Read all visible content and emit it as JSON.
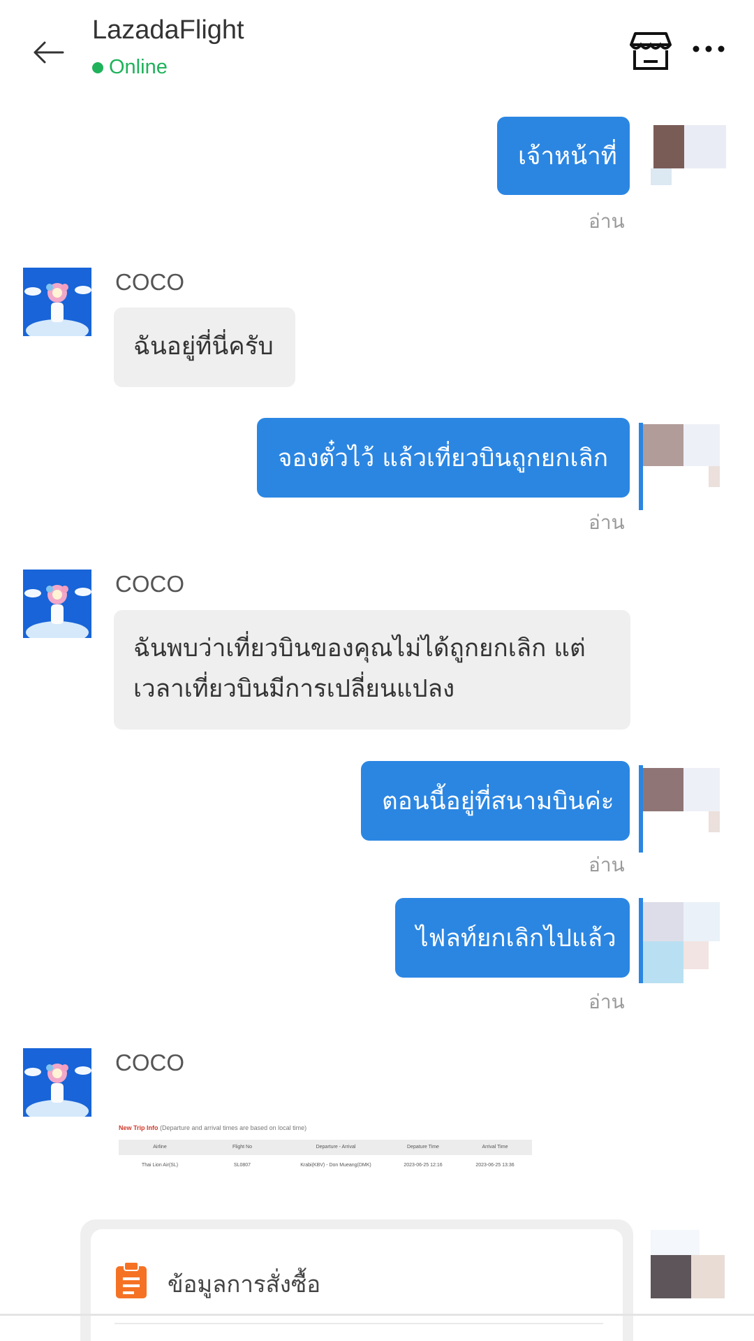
{
  "header": {
    "title": "LazadaFlight",
    "status": "Online",
    "back_icon": "arrow-left-icon",
    "store_icon": "store-icon",
    "more_icon": "more-horizontal-icon"
  },
  "messages": [
    {
      "from": "me",
      "text": "เจ้าหน้าที่",
      "status": "อ่าน"
    },
    {
      "from": "coco",
      "sender": "COCO",
      "text": "ฉันอยู่ที่นี่ครับ"
    },
    {
      "from": "me",
      "text": "จองตั๋วไว้ แล้วเที่ยวบินถูกยกเลิก",
      "status": "อ่าน"
    },
    {
      "from": "coco",
      "sender": "COCO",
      "text_lines": [
        "ฉันพบว่าเที่ยวบินของคุณไม่ได้ถูกยกเลิก แต่",
        "เวลาเที่ยวบินมีการเปลี่ยนแปลง"
      ]
    },
    {
      "from": "me",
      "text": "ตอนนี้อยู่ที่สนามบินค่ะ",
      "status": "อ่าน"
    },
    {
      "from": "me",
      "text": "ไฟลท์ยกเลิกไปแล้ว",
      "status": "อ่าน"
    },
    {
      "from": "coco",
      "sender": "COCO",
      "type": "image"
    }
  ],
  "trip_info": {
    "title": "New Trip Info",
    "note": "(Departure and arrival times are based on local time)",
    "columns": [
      "Airline",
      "Flight No",
      "Departure - Arrival",
      "Depature Time",
      "Arrival Time"
    ],
    "row": [
      "Thai Lion Air(SL)",
      "SL0807",
      "Krabi(KBV) - Don Mueang(DMK)",
      "2023-06-25 12:16",
      "2023-06-25 13:36"
    ]
  },
  "order_card": {
    "label": "ข้อมูลการสั่งซื้อ",
    "icon": "clipboard-icon"
  },
  "colors": {
    "outgoing_bubble": "#2b86e2",
    "incoming_bubble": "#efefef",
    "online": "#1fb25a",
    "order_icon": "#f57224"
  }
}
